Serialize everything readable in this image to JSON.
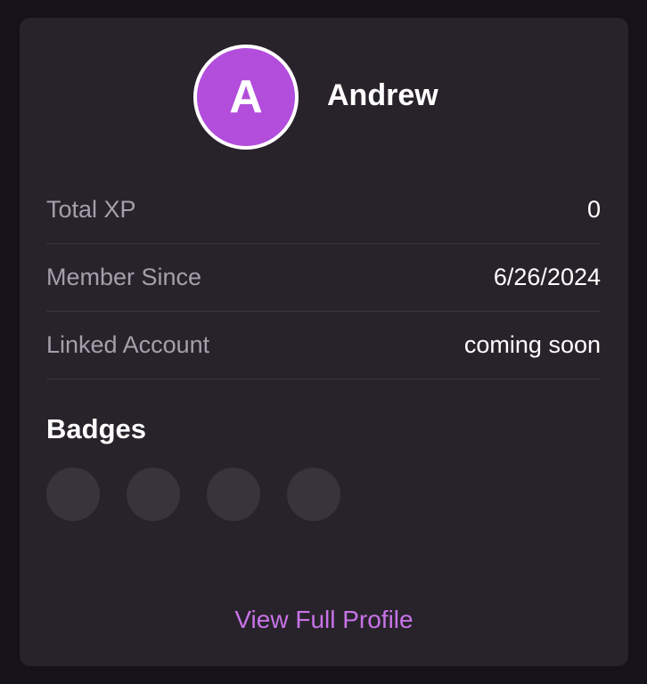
{
  "profile": {
    "avatar_initial": "A",
    "username": "Andrew"
  },
  "stats": [
    {
      "label": "Total XP",
      "value": "0"
    },
    {
      "label": "Member Since",
      "value": "6/26/2024"
    },
    {
      "label": "Linked Account",
      "value": "coming soon"
    }
  ],
  "badges": {
    "title": "Badges",
    "slots": [
      "empty",
      "empty",
      "empty",
      "empty"
    ]
  },
  "footer": {
    "link_label": "View Full Profile"
  },
  "colors": {
    "page_background": "#151219",
    "card_background": "#28232b",
    "avatar_background": "#b24ddc",
    "accent_link": "#c873e8",
    "muted_text": "#a3a0ab",
    "badge_placeholder": "#39343c"
  }
}
